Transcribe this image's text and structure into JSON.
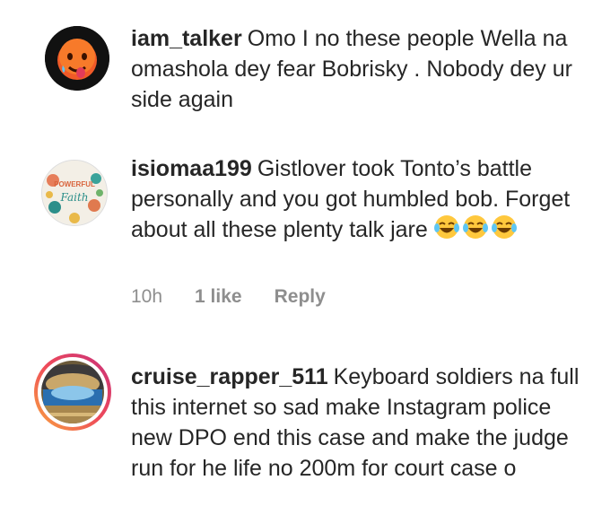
{
  "comments": [
    {
      "username": "iam_talker",
      "text": "Omo I no these people Wella na omashola dey fear Bobrisky . Nobody dey ur side again",
      "avatar_icon": "hot-face-emoji-icon"
    },
    {
      "username": "isiomaa199",
      "text": "Gistlover took Tonto’s battle personally and you got humbled bob. Forget about all these plenty talk jare",
      "emoji_suffix": "laughing-tears-emoji x3",
      "avatar_icon": "powerful-faith-avatar",
      "avatar_text_1": "POWERFUL",
      "avatar_text_2": "Faith",
      "time": "10h",
      "likes": "1 like",
      "reply_label": "Reply"
    },
    {
      "username": "cruise_rapper_511",
      "text": "Keyboard soldiers na full this internet so sad make Instagram police new DPO end this case and make the judge run for he life no 200m for court case o",
      "avatar_icon": "stadium-avatar"
    }
  ],
  "colors": {
    "text": "#262626",
    "meta": "#8e8e8e",
    "story_ring_start": "#f9a73e",
    "story_ring_end": "#c8307a"
  }
}
